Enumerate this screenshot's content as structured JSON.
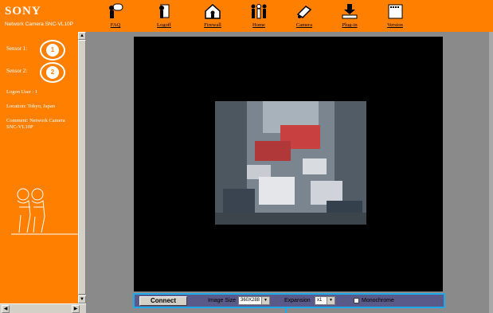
{
  "header": {
    "brand": "SONY",
    "subtitle": "Network Camera SNC-VL10P",
    "nav": [
      {
        "label": "FAQ",
        "icon": "faq-icon"
      },
      {
        "label": "Logoff",
        "icon": "logoff-icon"
      },
      {
        "label": "Firewall",
        "icon": "firewall-icon"
      },
      {
        "label": "Home",
        "icon": "home-icon"
      },
      {
        "label": "Camera",
        "icon": "camera-icon"
      },
      {
        "label": "Plug-in",
        "icon": "plugin-icon"
      },
      {
        "label": "Version",
        "icon": "version-icon"
      }
    ],
    "version_icon_text": "Ver."
  },
  "sidebar": {
    "sensor1_label": "Sensor 1:",
    "sensor1_badge": "1",
    "sensor2_label": "Sensor 2:",
    "sensor2_badge": "2",
    "logon_user": "Logon User : 1",
    "location": "Location: Tokyo, Japan",
    "comment_line1": "Comment: Network Camera",
    "comment_line2": "SNC-VL10P"
  },
  "controls": {
    "connect_label": "Connect",
    "image_size_label": "Image Size",
    "image_size_value": "360X288",
    "expansion_label": "Expansion",
    "expansion_value": "x1",
    "monochrome_label": "Monochrome"
  },
  "colors": {
    "accent": "#ff7f00",
    "panel_border": "#1ea9e8",
    "viewer_bg": "#000000"
  }
}
